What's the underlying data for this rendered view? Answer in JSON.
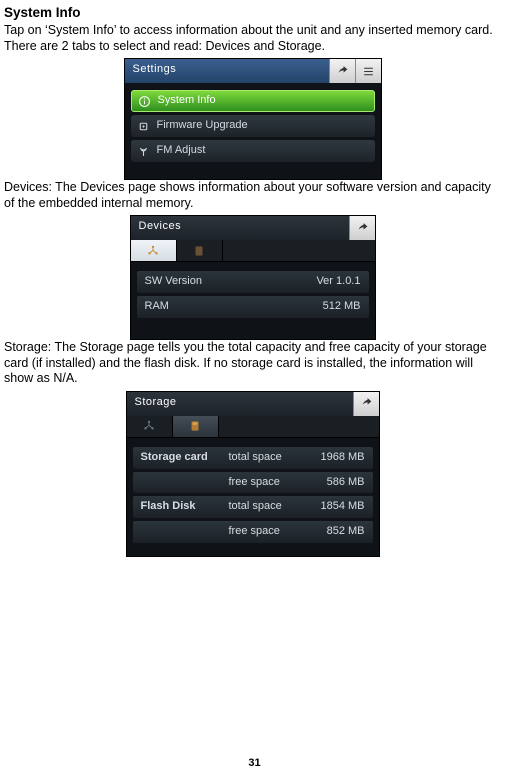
{
  "heading": "System Info",
  "intro": "Tap on ‘System Info’ to access information about the unit and any inserted memory card. There are 2 tabs to select and read: Devices and Storage.",
  "fig1": {
    "title": "Settings",
    "items": {
      "a": "System Info",
      "b": "Firmware Upgrade",
      "c": "FM Adjust"
    }
  },
  "devices_text": "Devices: The Devices page shows information about your software version and capacity of the embedded internal memory.",
  "fig2": {
    "title": "Devices",
    "rows": {
      "sw_label": "SW Version",
      "sw_value": "Ver 1.0.1",
      "ram_label": "RAM",
      "ram_value": "512 MB"
    }
  },
  "storage_text": "Storage: The Storage page tells you the total capacity and free capacity of your storage card (if installed) and the flash disk. If no storage card is installed, the information will show as N/A.",
  "fig3": {
    "title": "Storage",
    "rows": {
      "r1c1": "Storage card",
      "r1c2": "total space",
      "r1c3": "1968 MB",
      "r2c1": "",
      "r2c2": "free space",
      "r2c3": "586 MB",
      "r3c1": "Flash Disk",
      "r3c2": "total space",
      "r3c3": "1854 MB",
      "r4c1": "",
      "r4c2": "free space",
      "r4c3": "852 MB"
    }
  },
  "page_number": "31"
}
